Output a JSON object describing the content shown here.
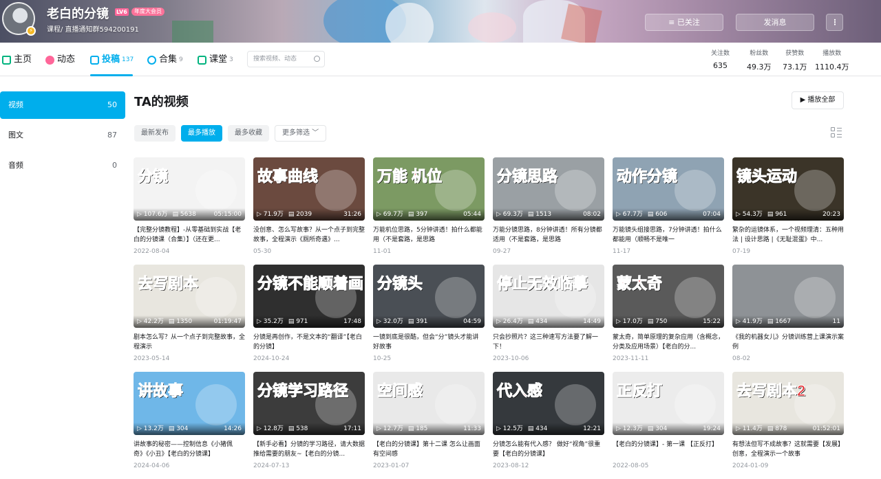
{
  "header": {
    "username": "老白的分镜",
    "level": "LV6",
    "vip_badge": "年度大会员",
    "sign": "课程/ 直播通知群594200191",
    "follow_label": "≡ 已关注",
    "message_label": "发消息",
    "more_label": "⋮"
  },
  "nav": {
    "home": "主页",
    "dynamic": "动态",
    "upload": "投稿",
    "upload_count": "137",
    "collection": "合集",
    "collection_count": "9",
    "course": "课堂",
    "course_count": "3",
    "search_placeholder": "搜索视频、动态"
  },
  "stats": [
    {
      "label": "关注数",
      "value": "635"
    },
    {
      "label": "粉丝数",
      "value": "49.3万"
    },
    {
      "label": "获赞数",
      "value": "73.1万"
    },
    {
      "label": "播放数",
      "value": "1110.4万"
    }
  ],
  "sidebar": [
    {
      "label": "视频",
      "count": "50"
    },
    {
      "label": "图文",
      "count": "87"
    },
    {
      "label": "音频",
      "count": "0"
    }
  ],
  "main": {
    "title": "TA的视频",
    "play_all": "▶ 播放全部",
    "tabs": [
      "最新发布",
      "最多播放",
      "最多收藏"
    ],
    "filter": "更多筛选 ﹀"
  },
  "videos": [
    {
      "cap": "分镜",
      "plays": "107.6万",
      "danmaku": "5638",
      "duration": "05:15:00",
      "title": "【完整分镜教程】-从零基础到实战【老白的分镜课（合集）】（还在更...",
      "date": "2022-08-04",
      "bg": "#f3f3f3"
    },
    {
      "cap": "故事曲线",
      "plays": "71.9万",
      "danmaku": "2039",
      "duration": "31:26",
      "title": "没创意、怎么写故事？从一个点子到完整故事，全程演示《厕所奇遇》...",
      "date": "05-30",
      "bg": "#6b4a3f"
    },
    {
      "cap": "万能 机位",
      "plays": "69.7万",
      "danmaku": "397",
      "duration": "05:44",
      "title": "万能机位思路，5分钟讲透！拍什么都能用（不是套路，是思路",
      "date": "11-01",
      "bg": "#7c9a63"
    },
    {
      "cap": "分镜思路",
      "plays": "69.3万",
      "danmaku": "1513",
      "duration": "08:02",
      "title": "万能分镜思路，8分钟讲透！所有分镜都适用（不是套路，是思路",
      "date": "09-27",
      "bg": "#9aa0a4"
    },
    {
      "cap": "动作分镜",
      "plays": "67.7万",
      "danmaku": "606",
      "duration": "07:04",
      "title": "万能镜头组接思路，7分钟讲透！拍什么都能用（顺畅不是唯一",
      "date": "11-17",
      "bg": "#8fa3b3"
    },
    {
      "cap": "镜头运动",
      "plays": "54.3万",
      "danmaku": "961",
      "duration": "20:23",
      "title": "繁杂的运镜体系，一个视频理清：五种用法 | 设计思路 |《无耻混蛋》中...",
      "date": "07-19",
      "bg": "#3b3428"
    },
    {
      "cap": "去写剧本",
      "plays": "42.2万",
      "danmaku": "1350",
      "duration": "01:19:47",
      "title": "剧本怎么写？从一个点子到完整故事，全程演示",
      "date": "2023-05-14",
      "bg": "#e8e6df"
    },
    {
      "cap": "分镜不能顺着画",
      "plays": "35.2万",
      "danmaku": "971",
      "duration": "17:48",
      "title": "分镜是再创作，不是文本的“翻译”【老白的分镜】",
      "date": "2024-10-24",
      "bg": "#2f2f2f"
    },
    {
      "cap": "分镜头",
      "plays": "32.0万",
      "danmaku": "391",
      "duration": "04:59",
      "title": "一镜到底是很酷，但会“分”镜头才能讲好故事",
      "date": "10-25",
      "bg": "#4a4f55"
    },
    {
      "cap": "停止无效临摹",
      "plays": "26.4万",
      "danmaku": "434",
      "duration": "14:49",
      "title": "只会抄照片？这三种速写方法要了解一下！",
      "date": "2023-10-06",
      "bg": "#e6e6e6"
    },
    {
      "cap": "蒙太奇",
      "plays": "17.0万",
      "danmaku": "750",
      "duration": "15:22",
      "title": "蒙太奇，简单原理的复杂应用（含概念，分类及应用场景）【老白的分...",
      "date": "2023-11-11",
      "bg": "#5a5a5a"
    },
    {
      "cap": "",
      "plays": "41.9万",
      "danmaku": "1667",
      "duration": "11",
      "title": "《我的机器女儿》分镜训练营上课演示案例",
      "date": "08-02",
      "bg": "#8e9296"
    },
    {
      "cap": "讲故事",
      "plays": "13.2万",
      "danmaku": "304",
      "duration": "14:26",
      "title": "讲故事的秘密——控制信息《小猪佩奇》《小丑》【老白的分镜课】",
      "date": "2024-04-06",
      "bg": "#6fb7e8"
    },
    {
      "cap": "分镜学习路径",
      "plays": "12.8万",
      "danmaku": "538",
      "duration": "17:11",
      "title": "【新手必看】分镜的学习路径，请大数据推给需要的朋友~【老白的分镜...",
      "date": "2024-07-13",
      "bg": "#3c3c3c"
    },
    {
      "cap": "空间感",
      "plays": "12.7万",
      "danmaku": "185",
      "duration": "11:33",
      "title": "【老白的分镜课】第十二课 怎么让画面有空间感",
      "date": "2023-01-07",
      "bg": "#e9e9e9"
    },
    {
      "cap": "代入感",
      "plays": "12.5万",
      "danmaku": "434",
      "duration": "12:21",
      "title": "分镜怎么能有代入感？ 做好“视角”很重要【老白的分镜课】",
      "date": "2023-08-12",
      "bg": "#35393d"
    },
    {
      "cap": "正反打",
      "plays": "12.3万",
      "danmaku": "304",
      "duration": "19:24",
      "title": "【老白的分镜课】- 第一课 【正反打】",
      "date": "2022-08-05",
      "bg": "#ececec"
    },
    {
      "cap": "去写剧本2",
      "plays": "11.4万",
      "danmaku": "878",
      "duration": "01:52:01",
      "title": "有想法但写不成故事？这就需要【发展】创意，全程演示一个故事",
      "date": "2024-01-09",
      "bg": "#e8e6df"
    }
  ]
}
